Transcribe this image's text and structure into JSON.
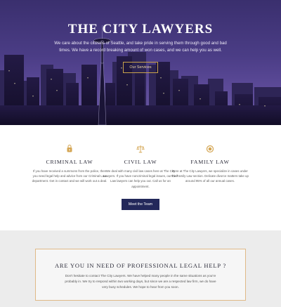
{
  "hero": {
    "title": "THE CITY LAWYERS",
    "text": "We care about the citizens of Seattle, and take pride in serving them through good and bad times. We have a record breaking amount of won cases, and we can help you as well.",
    "button_label": "Our Services"
  },
  "services": [
    {
      "icon": "handcuffs-icon",
      "title": "CRIMINAL LAW",
      "text": "If you have received a summons from the police, then you need legal help and advice from our Criminal Law department. Get in contact and we will work out a deal."
    },
    {
      "icon": "scales-icon",
      "title": "CIVIL LAW",
      "text": "We deal with many civil law cases here at The City Lawyers. If you have noncriminal legal issues, our Civil Law lawyers can help you out. Call us for an appointment."
    },
    {
      "icon": "rings-icon",
      "title": "FAMILY LAW",
      "text": "Here at The City Lawyers, we specialize in cases under the Family Law section. Delicate divorce matters take up around 95% of all our annual cases."
    }
  ],
  "team_button_label": "Meet the Team",
  "cta": {
    "title": "ARE YOU IN NEED OF PROFESSIONAL LEGAL HELP ?",
    "text": "Don't hesitate to contact The City Lawyers. We have helped many people in the same situations as you're probably in. We try to respond within two working days, but since we are a respected law firm, we do have very busy schedules. We hope to hear from you soon."
  },
  "colors": {
    "accent_gold": "#c9a24b",
    "button_navy": "#23285a",
    "hero_purple": "#4b3d86"
  }
}
